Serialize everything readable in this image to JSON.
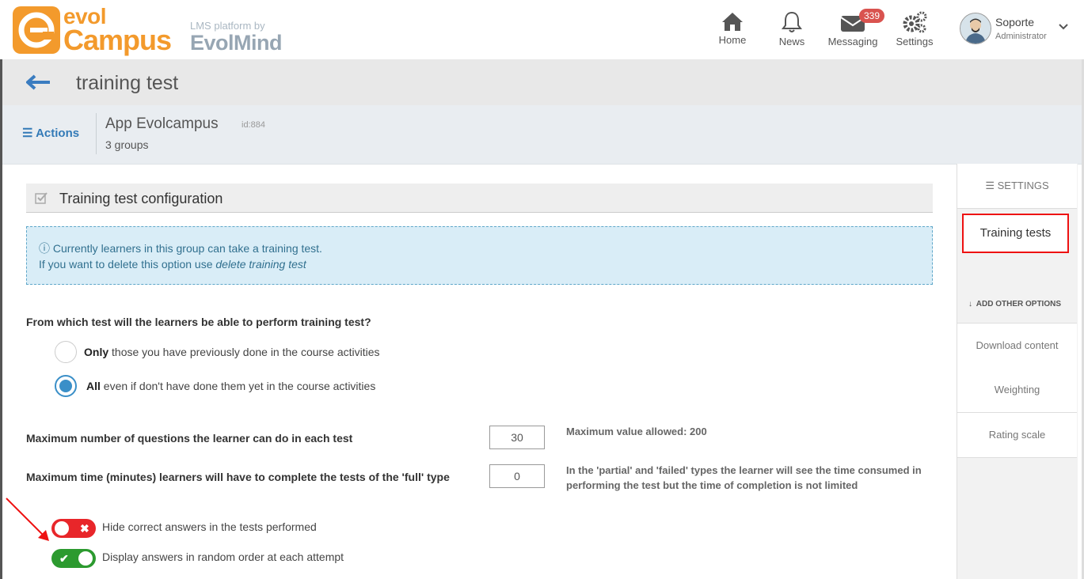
{
  "header": {
    "logo_evol": "evol",
    "logo_campus": "Campus",
    "logo_sub": "LMS platform by",
    "logo_mind": "EvolMind",
    "nav": [
      {
        "label": "Home",
        "icon": "home-icon"
      },
      {
        "label": "News",
        "icon": "bell-icon"
      },
      {
        "label": "Messaging",
        "icon": "envelope-icon",
        "badge": "339"
      },
      {
        "label": "Settings",
        "icon": "gears-icon"
      }
    ],
    "user": {
      "name": "Soporte",
      "role": "Administrator"
    }
  },
  "titlebar": {
    "title": "training test"
  },
  "context": {
    "actions_label": "Actions",
    "app_name": "App Evolcampus",
    "app_id": "id:884",
    "groups": "3 groups"
  },
  "panel": {
    "title": "Training test configuration",
    "info_line1": "Currently learners in this group can take a training test.",
    "info_line2_prefix": "If you want to delete this option use ",
    "info_line2_link": "delete training test"
  },
  "form": {
    "question": "From which test will the learners be able to perform training test?",
    "options": [
      {
        "bold": "Only",
        "text": " those you have previously done in the course activities",
        "selected": false
      },
      {
        "bold": "All",
        "text": " even if don't have done them yet in the course activities",
        "selected": true
      }
    ],
    "max_questions_label": "Maximum number of questions the learner can do in each test",
    "max_questions_value": "30",
    "max_questions_hint": "Maximum value allowed: 200",
    "max_time_label": "Maximum time (minutes) learners will have to complete the tests of the 'full' type",
    "max_time_value": "0",
    "max_time_hint_1": "In the 'partial' and 'failed' types the learner will see the time consumed in",
    "max_time_hint_2": "performing the test but the time of completion is not limited",
    "toggles": [
      {
        "label": "Hide correct answers in the tests performed",
        "on": false
      },
      {
        "label": "Display answers in random order at each attempt",
        "on": true
      }
    ]
  },
  "sidebar": {
    "settings_label": "SETTINGS",
    "training_tests_label": "Training tests",
    "add_other_label": "ADD OTHER OPTIONS",
    "options": [
      "Download content",
      "Weighting",
      "Rating scale"
    ]
  },
  "colors": {
    "brand_orange": "#f39a2c",
    "link_blue": "#337ab7",
    "toggle_off": "#e8262a",
    "toggle_on": "#2c9a2f",
    "highlight_red": "#ee1111"
  }
}
